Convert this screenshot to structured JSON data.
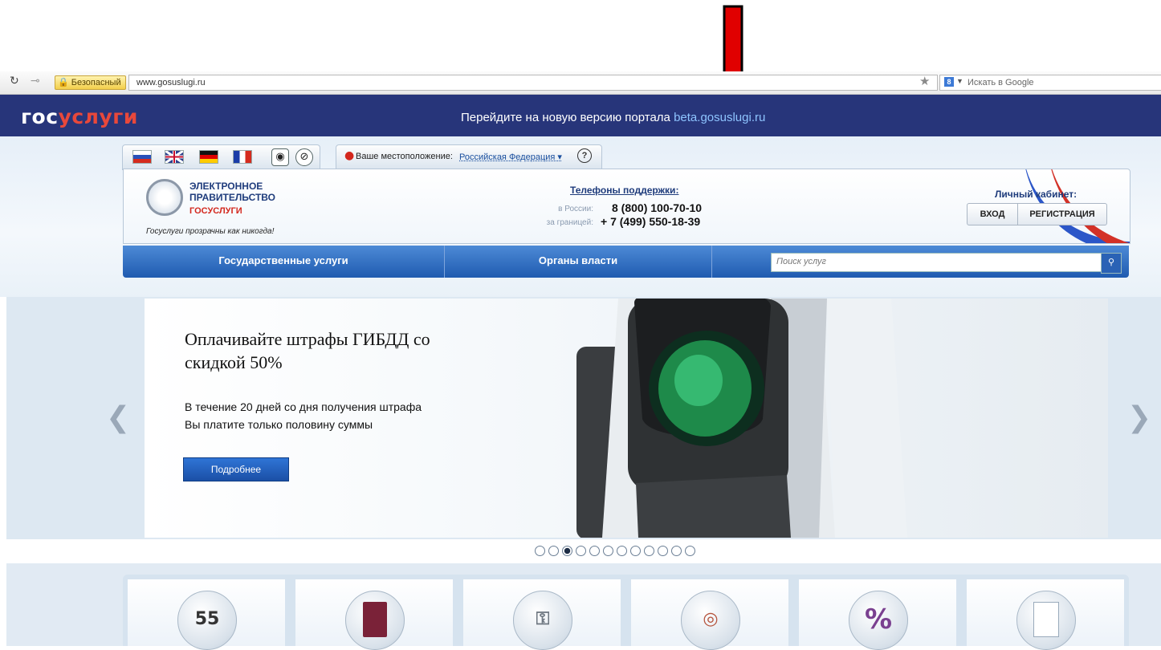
{
  "browser": {
    "secure_label": "Безопасный",
    "url": "www.gosuslugi.ru",
    "search_placeholder": "Искать в Google"
  },
  "topbar": {
    "logo_part1": "гос",
    "logo_part2": "услуги",
    "banner_text": "Перейдите на новую версию портала ",
    "banner_link": "beta.gosuslugi.ru"
  },
  "header": {
    "location_label": "Ваше местоположение:",
    "location_value": "Российская Федерация ▾",
    "help_label": "?",
    "egov_line1": "ЭЛЕКТРОННОЕ",
    "egov_line2": "ПРАВИТЕЛЬСТВО",
    "egov_line3": "ГОСУСЛУГИ",
    "slogan": "Госуслуги прозрачны как никогда!",
    "support_title": "Телефоны поддержки",
    "support_colon": ":",
    "phones": [
      {
        "label": "в России:",
        "number": "8 (800) 100-70-10"
      },
      {
        "label": "за границей:",
        "number": "+ 7 (499) 550-18-39"
      }
    ],
    "cabinet_title": "Личный кабинет:",
    "login_label": "ВХОД",
    "register_label": "РЕГИСТРАЦИЯ"
  },
  "nav": {
    "services": "Государственные услуги",
    "authorities": "Органы власти",
    "search_placeholder": "Поиск услуг"
  },
  "slide": {
    "title": "Оплачивайте штрафы ГИБДД со скидкой 50%",
    "desc_line1": "В течение 20 дней со дня получения штрафа",
    "desc_line2": "Вы платите только половину суммы",
    "button": "Подробнее"
  },
  "carousel": {
    "total_slides": 12,
    "active_index": 2
  },
  "tiles": [
    {
      "icon": "calendar-icon",
      "label": "55"
    },
    {
      "icon": "passport-icon",
      "label": ""
    },
    {
      "icon": "keys-icon",
      "label": ""
    },
    {
      "icon": "lifebuoy-icon",
      "label": ""
    },
    {
      "icon": "percent-icon",
      "label": "%"
    },
    {
      "icon": "certificate-icon",
      "label": ""
    }
  ],
  "colors": {
    "topbar": "#27357a",
    "logo_accent": "#e8483b",
    "link": "#8ec4ff",
    "nav": "#1f5bb0",
    "annotation_arrow": "#e00000"
  }
}
